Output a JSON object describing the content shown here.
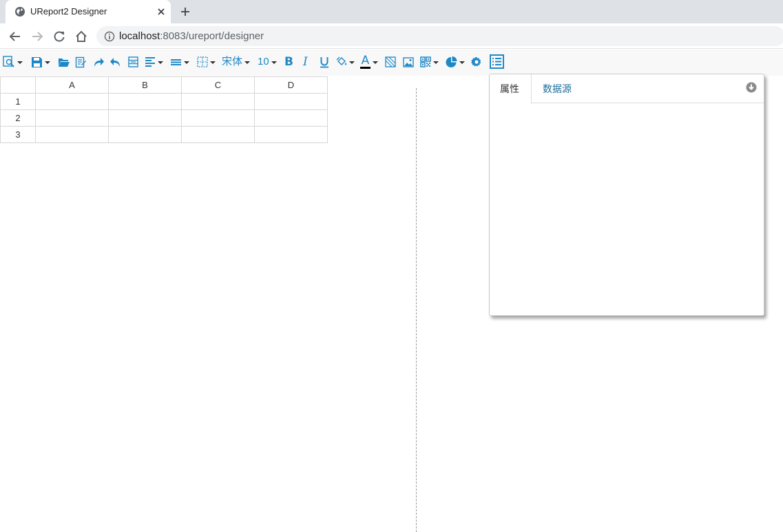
{
  "browser": {
    "tab_title": "UReport2 Designer",
    "url_host": "localhost",
    "url_rest": ":8083/ureport/designer"
  },
  "toolbar": {
    "icons": [
      "preview-icon",
      "save-icon",
      "open-folder-icon",
      "import-icon",
      "redo-icon",
      "undo-icon",
      "merge-cells-icon",
      "align-left-icon",
      "valign-icon",
      "border-icon",
      "font-family",
      "font-size",
      "bold-icon",
      "italic-icon",
      "underline-icon",
      "fill-color-icon",
      "font-color-icon",
      "slash-icon",
      "image-icon",
      "barcode-icon",
      "chart-icon",
      "settings-icon",
      "properties-panel-icon"
    ],
    "font_family": "宋体",
    "font_size": "10",
    "bold_label": "B",
    "italic_label": "I",
    "font_color_label": "A",
    "accent_color": "#1e88c7"
  },
  "grid": {
    "columns": [
      "A",
      "B",
      "C",
      "D"
    ],
    "rows": [
      "1",
      "2",
      "3"
    ]
  },
  "panel": {
    "tabs": [
      "属性",
      "数据源"
    ],
    "active_tab": "属性"
  }
}
